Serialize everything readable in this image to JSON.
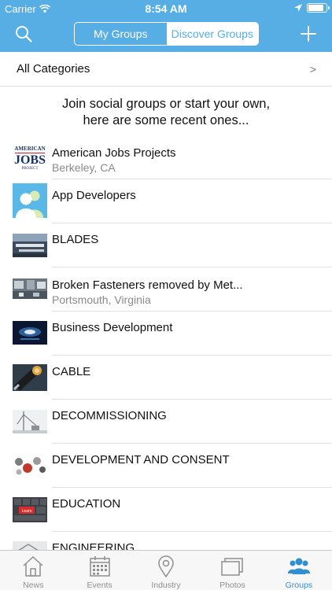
{
  "status_bar": {
    "carrier": "Carrier",
    "time": "8:54 AM",
    "battery_level": 0.95
  },
  "nav": {
    "search_icon": "search-icon",
    "add_icon": "plus-icon",
    "segments": [
      {
        "label": "My Groups",
        "selected": false
      },
      {
        "label": "Discover Groups",
        "selected": true
      }
    ]
  },
  "categories": {
    "label": "All Categories",
    "chevron": ">"
  },
  "intro": {
    "line1": "Join social groups or start your own,",
    "line2": "here are some recent ones..."
  },
  "groups": [
    {
      "title": "American Jobs Projects",
      "subtitle": "Berkeley, CA",
      "logo_text": [
        "AMERICAN",
        "JOBS",
        "PROJECT"
      ]
    },
    {
      "title": "App Developers",
      "subtitle": ""
    },
    {
      "title": "BLADES",
      "subtitle": ""
    },
    {
      "title": "Broken Fasteners removed by Met...",
      "subtitle": "Portsmouth, Virginia"
    },
    {
      "title": "Business Development",
      "subtitle": ""
    },
    {
      "title": "CABLE",
      "subtitle": ""
    },
    {
      "title": "DECOMMISSIONING",
      "subtitle": ""
    },
    {
      "title": "DEVELOPMENT AND CONSENT",
      "subtitle": ""
    },
    {
      "title": "EDUCATION",
      "subtitle": "",
      "keyboard_key": "Learn"
    },
    {
      "title": "ENGINEERING",
      "subtitle": ""
    }
  ],
  "tabbar": {
    "tabs": [
      {
        "label": "News",
        "icon": "house-icon",
        "active": false
      },
      {
        "label": "Events",
        "icon": "calendar-icon",
        "active": false
      },
      {
        "label": "Industry",
        "icon": "map-pin-icon",
        "active": false
      },
      {
        "label": "Photos",
        "icon": "photos-icon",
        "active": false
      },
      {
        "label": "Groups",
        "icon": "people-icon",
        "active": true
      }
    ]
  },
  "colors": {
    "header_bg": "#56aee5",
    "active_tab": "#2f8fd1",
    "inactive_tab": "#8e8e8e"
  }
}
